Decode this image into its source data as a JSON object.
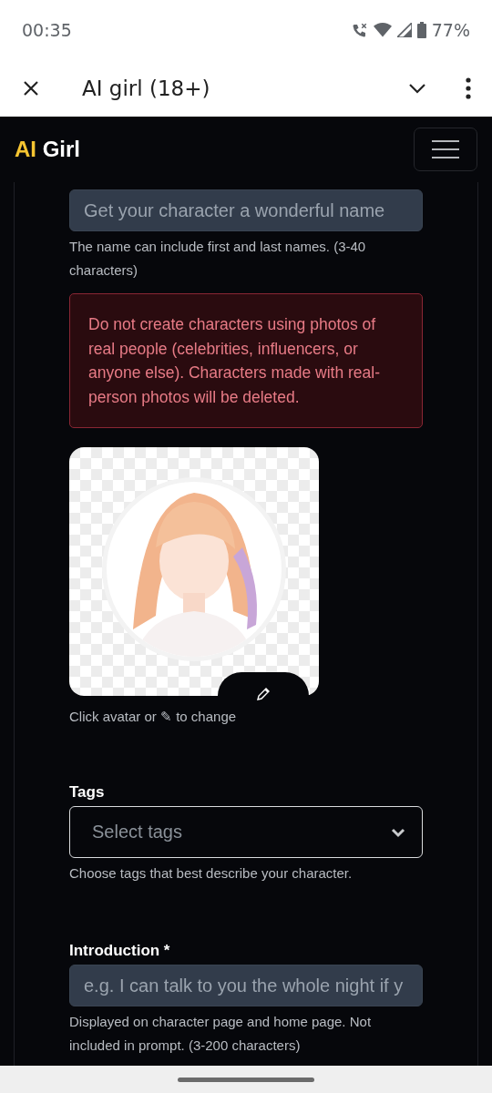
{
  "status_bar": {
    "time": "00:35",
    "battery": "77%"
  },
  "toolbar": {
    "title": "AI girl (18+)"
  },
  "navbar": {
    "logo_accent": "AI",
    "logo_rest": "Girl"
  },
  "form": {
    "name_field": {
      "placeholder": "Get your character a wonderful name",
      "hint": "The name can include first and last names. (3-40 characters)"
    },
    "warning": "Do not create characters using photos of real people (celebrities, influencers, or anyone else). Characters made with real-person photos will be deleted.",
    "avatar": {
      "kind": "picture",
      "caption": "Click avatar or ✎ to change"
    },
    "tags": {
      "label": "Tags",
      "placeholder": "Select tags",
      "hint": "Choose tags that best describe your character."
    },
    "introduction": {
      "label": "Introduction *",
      "placeholder": "e.g. I can talk to you the whole night if y",
      "hint": "Displayed on character page and home page. Not included in prompt. (3-200 characters)"
    }
  }
}
